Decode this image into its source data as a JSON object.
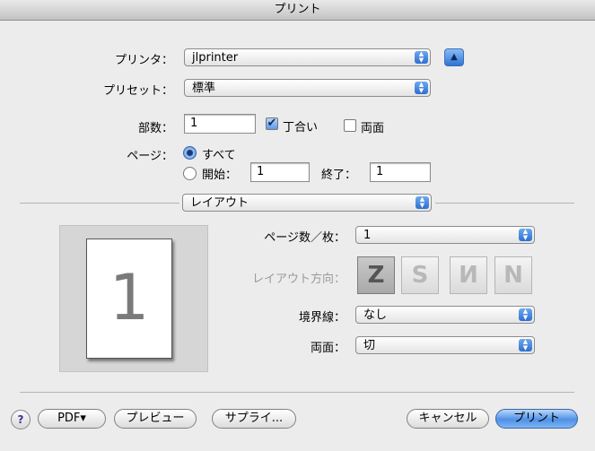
{
  "window": {
    "title": "プリント"
  },
  "printer": {
    "label": "プリンタ：",
    "value": "jlprinter"
  },
  "presets": {
    "label": "プリセット：",
    "value": "標準"
  },
  "copies": {
    "label": "部数：",
    "value": "1",
    "collate_label": "丁合い",
    "collate_checked": true,
    "duplex_label": "両面",
    "duplex_checked": false
  },
  "pages": {
    "label": "ページ：",
    "all_label": "すべて",
    "from_label": "開始：",
    "from_value": "1",
    "to_label": "終了：",
    "to_value": "1",
    "selected": "all"
  },
  "section": {
    "value": "レイアウト"
  },
  "layout": {
    "preview_page_number": "1",
    "pages_per_sheet_label": "ページ数／枚：",
    "pages_per_sheet_value": "1",
    "direction_label": "レイアウト方向：",
    "directions": [
      "Z",
      "S",
      "И",
      "N"
    ],
    "border_label": "境界線：",
    "border_value": "なし",
    "duplex_label": "両面：",
    "duplex_value": "切"
  },
  "buttons": {
    "help": "?",
    "pdf": "PDF▾",
    "preview": "プレビュー",
    "supplies": "サプライ...",
    "cancel": "キャンセル",
    "print": "プリント"
  }
}
